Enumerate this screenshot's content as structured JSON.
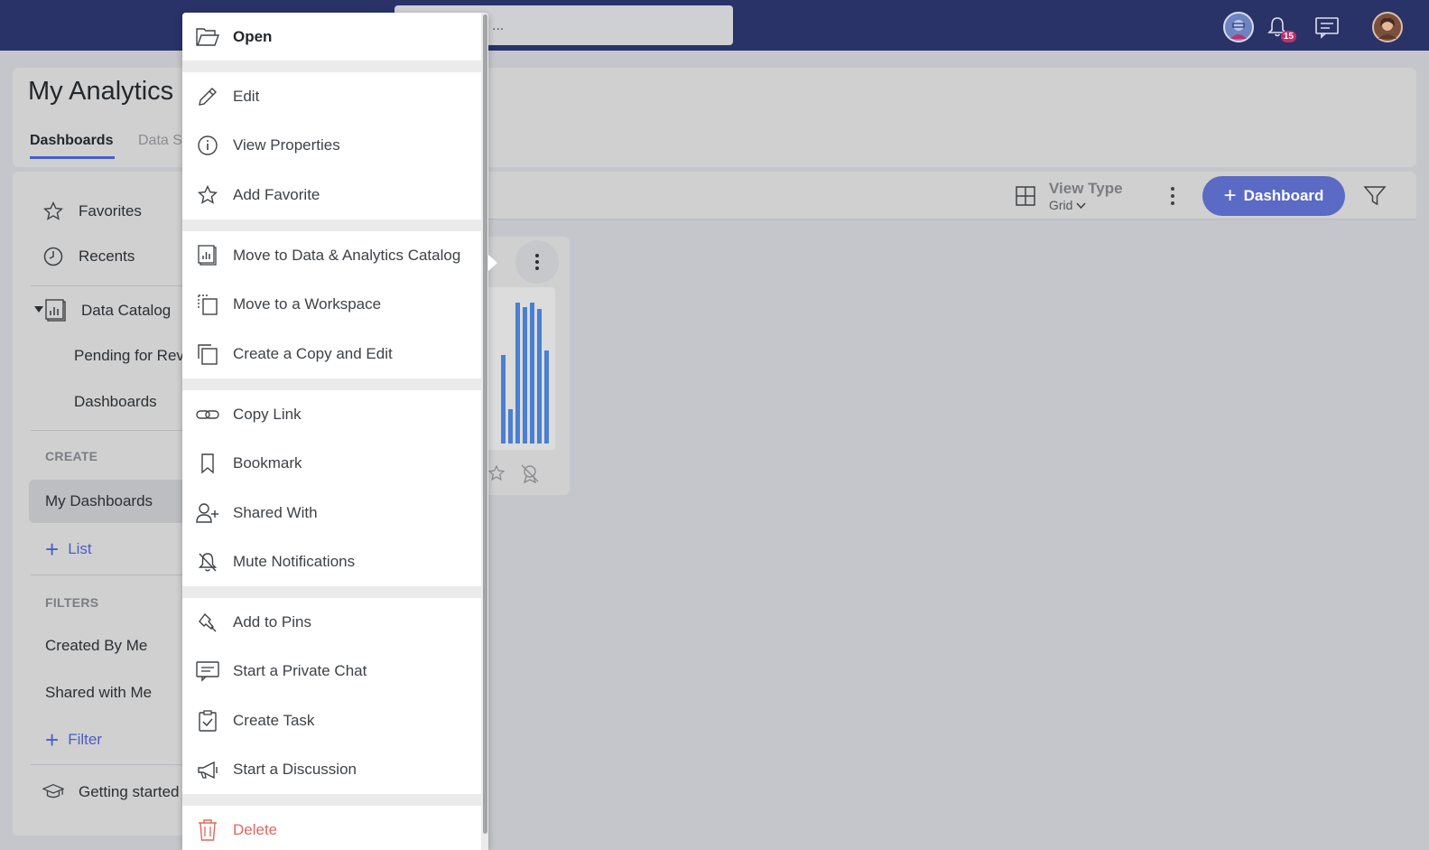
{
  "topbar": {
    "search_placeholder": "...",
    "notification_count": "15"
  },
  "header": {
    "title": "My Analytics",
    "tabs": [
      {
        "label": "Dashboards"
      },
      {
        "label": "Data S"
      }
    ]
  },
  "sidebar": {
    "favorites": "Favorites",
    "recents": "Recents",
    "data_catalog": "Data Catalog",
    "pending": "Pending for Rev",
    "dashboards": "Dashboards",
    "create_header": "CREATE",
    "my_dashboards": "My Dashboards",
    "add_list": "List",
    "filters_header": "FILTERS",
    "created_by_me": "Created By Me",
    "shared_with_me": "Shared with Me",
    "add_filter": "Filter",
    "getting_started": "Getting started"
  },
  "toolbar": {
    "view_type_label": "View Type",
    "view_type_value": "Grid",
    "add_dashboard_label": "Dashboard"
  },
  "context_menu": {
    "open": "Open",
    "edit": "Edit",
    "view_properties": "View Properties",
    "add_favorite": "Add Favorite",
    "move_catalog": "Move to Data & Analytics Catalog",
    "move_workspace": "Move to a Workspace",
    "copy_edit": "Create a Copy and Edit",
    "copy_link": "Copy Link",
    "bookmark": "Bookmark",
    "shared_with": "Shared With",
    "mute": "Mute Notifications",
    "pins": "Add to Pins",
    "private_chat": "Start a Private Chat",
    "create_task": "Create Task",
    "discussion": "Start a Discussion",
    "delete": "Delete"
  },
  "colors": {
    "topbar": "#293368",
    "accent": "#4a5ec4",
    "button": "#5a6ac5",
    "danger": "#e0675f",
    "chart_bar": "#4a7fd1"
  }
}
